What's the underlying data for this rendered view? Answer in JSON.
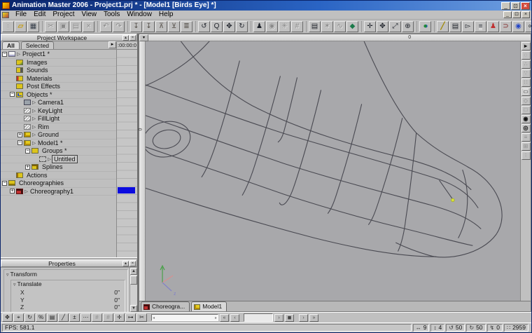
{
  "window": {
    "title": "Animation Master 2006 - Project1.prj * - [Model1 [Birds Eye] *]",
    "min": "_",
    "restore": "⊡",
    "close": "×"
  },
  "menu": {
    "items": [
      {
        "label": "File"
      },
      {
        "label": "Edit"
      },
      {
        "label": "Project"
      },
      {
        "label": "View"
      },
      {
        "label": "Tools"
      },
      {
        "label": "Window"
      },
      {
        "label": "Help"
      }
    ]
  },
  "toolbar": {
    "file": [
      {
        "n": "new",
        "g": "▯",
        "c": "ic-new"
      },
      {
        "n": "open",
        "g": "▱",
        "c": "ic-open"
      },
      {
        "n": "save",
        "g": "▦",
        "c": "ic-save"
      }
    ],
    "edit": [
      {
        "n": "cut",
        "g": "✂",
        "c": "dis"
      },
      {
        "n": "copy",
        "g": "▣",
        "c": "dis"
      },
      {
        "n": "paste",
        "g": "▤",
        "c": "dis"
      },
      {
        "n": "delete",
        "g": "×",
        "c": "dis"
      }
    ],
    "undo": [
      {
        "n": "undo",
        "g": "↶",
        "c": "dis"
      },
      {
        "n": "redo",
        "g": "↷",
        "c": "dis"
      }
    ],
    "embed": [
      {
        "n": "embed-a",
        "g": "↧",
        "c": "dim"
      },
      {
        "n": "embed-b",
        "g": "↧",
        "c": "dim"
      },
      {
        "n": "consolidate-a",
        "g": "⊼",
        "c": "dim"
      },
      {
        "n": "consolidate-b",
        "g": "⊻",
        "c": "dim"
      },
      {
        "n": "layout",
        "g": "≣",
        "c": "dim"
      }
    ],
    "view": [
      {
        "n": "pan",
        "g": "↺",
        "c": ""
      },
      {
        "n": "zoom",
        "g": "Q",
        "c": ""
      },
      {
        "n": "move",
        "g": "✥",
        "c": ""
      },
      {
        "n": "turn",
        "g": "↻",
        "c": ""
      }
    ],
    "mode1": [
      {
        "n": "character",
        "g": "♟",
        "c": ""
      },
      {
        "n": "progressive-render",
        "g": "◉",
        "c": "dis"
      },
      {
        "n": "render-mode",
        "g": "✳",
        "c": "dis"
      },
      {
        "n": "grid-snap",
        "g": "#",
        "c": "dis"
      }
    ],
    "mode2": [
      {
        "n": "library",
        "g": "▤",
        "c": ""
      },
      {
        "n": "render-preview",
        "g": "✶",
        "c": "dis"
      },
      {
        "n": "wave",
        "g": "∿",
        "c": "dis"
      },
      {
        "n": "plugin",
        "g": "◆",
        "c": "green"
      }
    ],
    "nav": [
      {
        "n": "snap-cross",
        "g": "✛",
        "c": ""
      },
      {
        "n": "move-tool",
        "g": "✥",
        "c": ""
      },
      {
        "n": "scale-tool",
        "g": "⤢",
        "c": ""
      },
      {
        "n": "globe-grid",
        "g": "⊕",
        "c": ""
      }
    ],
    "earth": [
      {
        "n": "earth",
        "g": "●",
        "c": "earth"
      }
    ],
    "model": [
      {
        "n": "spline-tool",
        "g": "╱",
        "c": "yellow"
      },
      {
        "n": "key-properties",
        "g": "▤",
        "c": ""
      },
      {
        "n": "select-arrow",
        "g": "▻",
        "c": ""
      },
      {
        "n": "equalize",
        "g": "≡",
        "c": "press"
      },
      {
        "n": "bones-mode",
        "g": "♟",
        "c": "red"
      },
      {
        "n": "muscle-mode",
        "g": "⊃",
        "c": "darkred"
      },
      {
        "n": "sphere-primitive",
        "g": "◉",
        "c": "blue"
      },
      {
        "n": "chain",
        "g": "∞",
        "c": ""
      },
      {
        "n": "font-wizard",
        "g": "A",
        "c": "bold"
      }
    ]
  },
  "workspace": {
    "header": "Project Workspace",
    "collapse_btn": "▴",
    "close_btn": "×",
    "tab_all": "All",
    "tab_selected": "Selected",
    "tab_scroll": "▸",
    "timeline_header": ":00:00:0",
    "tree": [
      {
        "cls": "i0",
        "exp": "−",
        "icon": "ic-doc",
        "mk": "▷",
        "label": "Project1 *",
        "lblc": ""
      },
      {
        "cls": "i1",
        "exp": "",
        "icon": "ic-img",
        "mk": "",
        "label": "Images",
        "lblc": ""
      },
      {
        "cls": "i1",
        "exp": "",
        "icon": "ic-snd",
        "mk": "",
        "label": "Sounds",
        "lblc": ""
      },
      {
        "cls": "i1",
        "exp": "",
        "icon": "ic-mat",
        "mk": "",
        "label": "Materials",
        "lblc": ""
      },
      {
        "cls": "i1",
        "exp": "",
        "icon": "ic-pfx",
        "mk": "",
        "label": "Post Effects",
        "lblc": ""
      },
      {
        "cls": "i1",
        "exp": "−",
        "icon": "ic-obj",
        "mk": "",
        "label": "Objects *",
        "lblc": ""
      },
      {
        "cls": "i2",
        "exp": "",
        "icon": "ic-cam",
        "mk": "▷",
        "label": "Camera1",
        "lblc": ""
      },
      {
        "cls": "i2",
        "exp": "",
        "icon": "ic-lgt",
        "mk": "▷",
        "label": "KeyLight",
        "lblc": ""
      },
      {
        "cls": "i2",
        "exp": "",
        "icon": "ic-lgt",
        "mk": "▷",
        "label": "FillLight",
        "lblc": ""
      },
      {
        "cls": "i2",
        "exp": "",
        "icon": "ic-lgt",
        "mk": "▷",
        "label": "Rim",
        "lblc": ""
      },
      {
        "cls": "i2",
        "exp": "+",
        "icon": "ic-fig",
        "mk": "▷",
        "label": "Ground",
        "lblc": ""
      },
      {
        "cls": "i2",
        "exp": "−",
        "icon": "ic-fig",
        "mk": "▷",
        "label": "Model1 *",
        "lblc": ""
      },
      {
        "cls": "i3",
        "exp": "−",
        "icon": "ic-grp",
        "mk": "",
        "label": "Groups *",
        "lblc": ""
      },
      {
        "cls": "i4",
        "exp": "",
        "icon": "ic-sel",
        "mk": "▷",
        "label": "Untitled",
        "lblc": "sel"
      },
      {
        "cls": "i3",
        "exp": "+",
        "icon": "ic-spl",
        "mk": "",
        "label": "Splines",
        "lblc": ""
      },
      {
        "cls": "i1",
        "exp": "",
        "icon": "ic-act",
        "mk": "",
        "label": "Actions",
        "lblc": ""
      },
      {
        "cls": "i0",
        "exp": "−",
        "icon": "ic-cho",
        "mk": "",
        "label": "Choreographies",
        "lblc": ""
      },
      {
        "cls": "i1",
        "exp": "+",
        "icon": "ic-chr",
        "mk": "▷",
        "label": "Choreography1",
        "lblc": ""
      }
    ]
  },
  "properties": {
    "header": "Properties",
    "caret": "▿",
    "group1": "Transform",
    "group2": "Translate",
    "rows": [
      {
        "label": "X",
        "value": "0\""
      },
      {
        "label": "Y",
        "value": "0\""
      },
      {
        "label": "Z",
        "value": "0\""
      }
    ],
    "scroll_up": "▲",
    "scroll_down": "▼"
  },
  "viewport": {
    "dropdown": "▾",
    "ruler_zero_top": "0",
    "ruler_zero_left": "0",
    "axis_z_label": "z",
    "wireframe_color": "#4a4a52",
    "selected_point_color": "#d6e03a",
    "tools": [
      {
        "n": "pointer-tool",
        "g": "▸",
        "c": "en"
      },
      {
        "n": "lasso-tool",
        "g": "◌",
        "c": "dis"
      },
      {
        "n": "add-point-tool",
        "g": "∴",
        "c": "dis"
      },
      {
        "n": "add-lathe-tool",
        "g": "∵",
        "c": "dis"
      },
      {
        "n": "patch-select-tool",
        "g": "∷",
        "c": "dis"
      },
      {
        "n": "group-marquee-tool",
        "g": "▭",
        "c": "press"
      },
      {
        "n": "polygon-tool",
        "g": "◇",
        "c": "dis"
      },
      {
        "n": "shape-tool",
        "g": "□",
        "c": "dis"
      },
      {
        "n": "turn-tool",
        "g": "◉",
        "c": "en"
      },
      {
        "n": "orbit-tool",
        "g": "◎",
        "c": "en"
      },
      {
        "n": "rows-tool",
        "g": "≡",
        "c": "dis"
      },
      {
        "n": "grid-tool",
        "g": "⊞",
        "c": "dis"
      },
      {
        "n": "detail-tool",
        "g": "∶",
        "c": "dis"
      }
    ],
    "tabs": [
      {
        "label": "Choreogra...",
        "c": "",
        "ic": "ic-chr"
      },
      {
        "label": "Model1",
        "c": "act",
        "ic": "ic-fig"
      }
    ]
  },
  "transport": {
    "icons": [
      {
        "n": "move-mode",
        "g": "✥",
        "c": ""
      },
      {
        "n": "scale-mode",
        "g": "⌖",
        "c": ""
      },
      {
        "n": "rotate-mode",
        "g": "↻",
        "c": ""
      },
      {
        "n": "percent",
        "g": "%",
        "c": ""
      },
      {
        "n": "library-panel",
        "g": "▤",
        "c": ""
      },
      {
        "n": "spline-mode",
        "g": "╱",
        "c": ""
      },
      {
        "n": "offset",
        "g": "±",
        "c": ""
      },
      {
        "n": "more",
        "g": "⋯",
        "c": ""
      },
      {
        "n": "grid-a",
        "g": "#",
        "c": "dis"
      },
      {
        "n": "grid-b",
        "g": "#",
        "c": "dis"
      },
      {
        "n": "skeletal",
        "g": "✛",
        "c": ""
      },
      {
        "n": "key-filter",
        "g": "⊶",
        "c": ""
      },
      {
        "n": "crop",
        "g": "✂",
        "c": ""
      }
    ],
    "slider_left": "◂",
    "slider_right": "▸",
    "left_buttons": [
      {
        "n": "go-start",
        "g": "«"
      },
      {
        "n": "step-back",
        "g": "‹"
      }
    ],
    "frame_value": "",
    "mid_buttons": [
      {
        "n": "play",
        "g": "›"
      },
      {
        "n": "stop",
        "g": "◼"
      }
    ],
    "right_buttons": [
      {
        "n": "step-forward",
        "g": "›"
      },
      {
        "n": "go-end",
        "g": "»"
      }
    ]
  },
  "status": {
    "fps": "FPS: 581.1",
    "cells": [
      {
        "n": "extent-x",
        "g": "↔",
        "v": "9"
      },
      {
        "n": "extent-y",
        "g": "↕",
        "v": "4"
      },
      {
        "n": "turn-angle",
        "g": "↺",
        "v": "50"
      },
      {
        "n": "roll-angle",
        "g": "↻",
        "v": "50"
      },
      {
        "n": "keys",
        "g": "↯",
        "v": "0"
      },
      {
        "n": "points",
        "g": "∷",
        "v": "2959"
      }
    ]
  }
}
